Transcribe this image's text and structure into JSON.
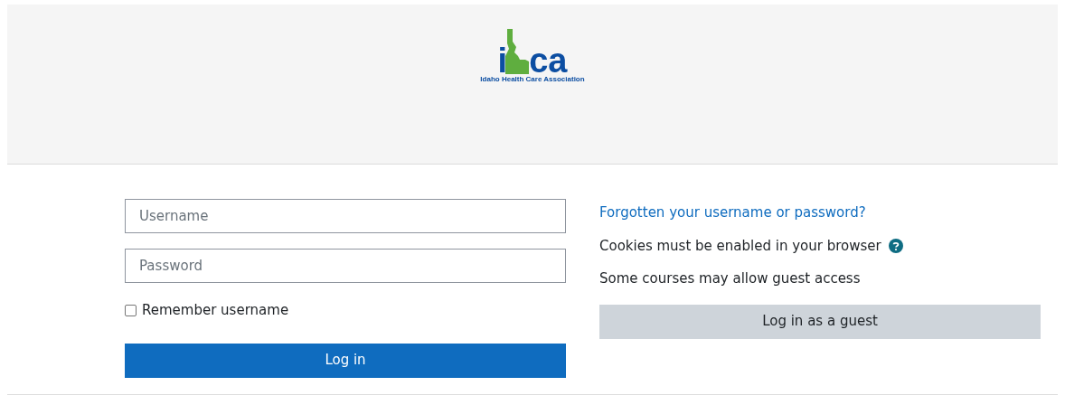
{
  "logo": {
    "letter": "i",
    "suffix": "ca",
    "tagline": "Idaho Health Care Association"
  },
  "login_form": {
    "username": {
      "placeholder": "Username"
    },
    "password": {
      "placeholder": "Password"
    },
    "remember": {
      "label": "Remember username",
      "checked": false
    },
    "submit": "Log in"
  },
  "side": {
    "forgot_link": "Forgotten your username or password?",
    "cookies_note": "Cookies must be enabled in your browser",
    "guest_note": "Some courses may allow guest access",
    "guest_button": "Log in as a guest"
  }
}
